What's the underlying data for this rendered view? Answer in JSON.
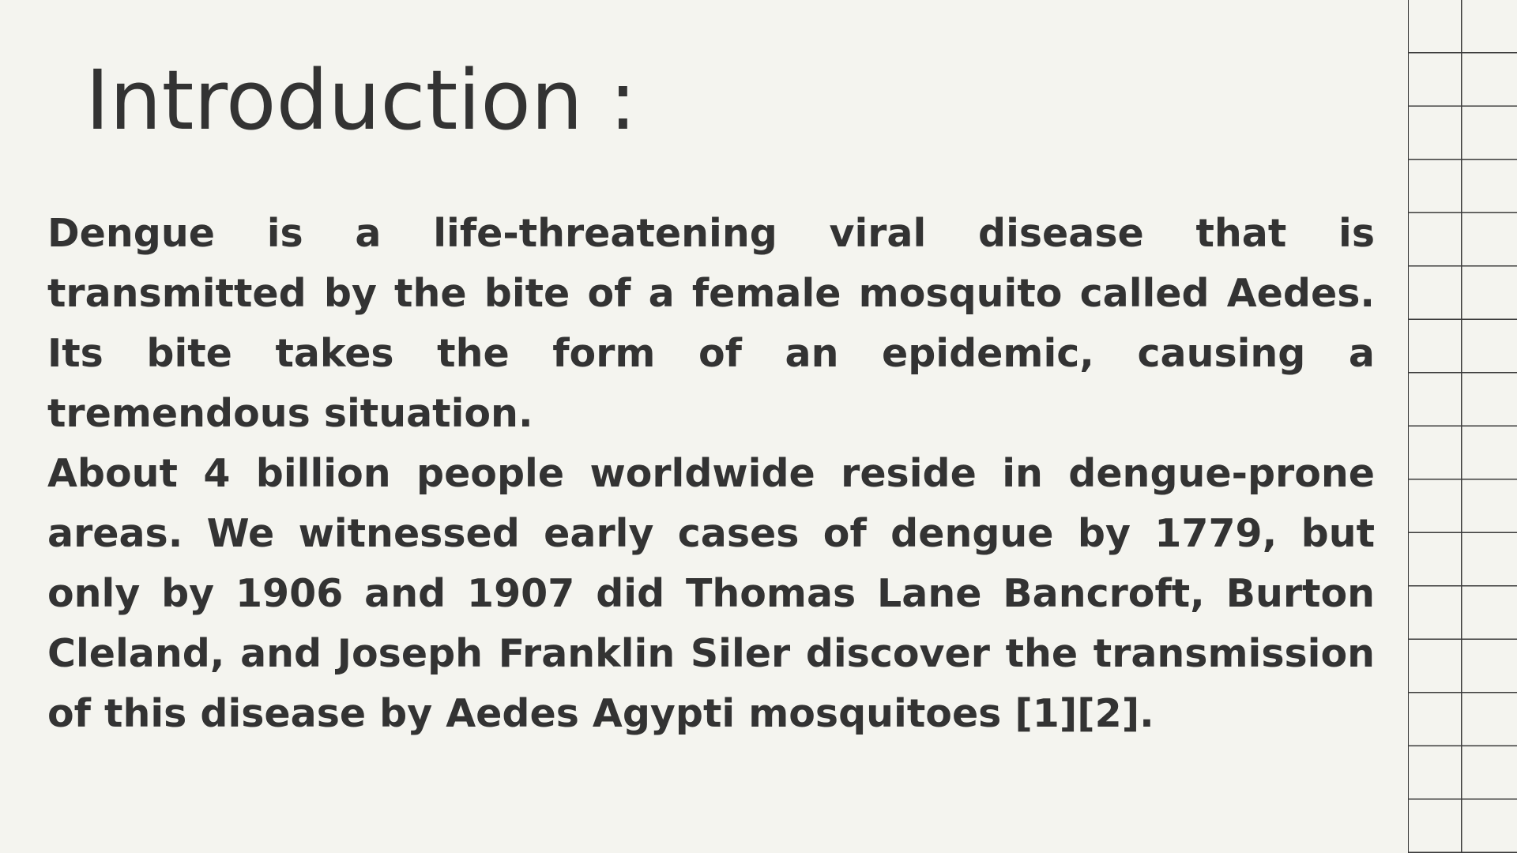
{
  "slide": {
    "title": "Introduction :",
    "paragraphs": [
      "Dengue is a life-threatening viral disease that is transmitted by the bite of a female mosquito called Aedes. Its bite takes the form of an epidemic, causing a tremendous situation.",
      "About 4 billion people worldwide reside in dengue-prone areas. We witnessed early cases of dengue by 1779, but only by 1906 and 1907 did Thomas Lane Bancroft, Burton Cleland, and Joseph Franklin Siler discover the transmission of this disease by Aedes Agypti mosquitoes [1][2]."
    ]
  },
  "colors": {
    "background": "#f4f4ef",
    "text": "#333333",
    "grid_lines": "#3a3a3a"
  }
}
